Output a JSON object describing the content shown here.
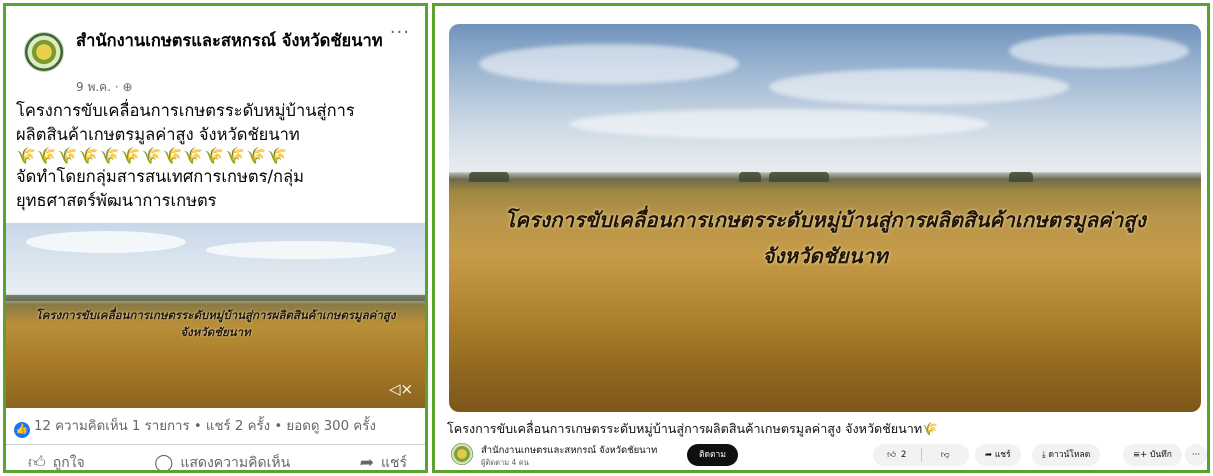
{
  "facebook_post": {
    "page_name": "สำนักงานเกษตรและสหกรณ์ จังหวัดชัยนาท",
    "date": "9 พ.ค. · ",
    "audience_icon": "globe-icon",
    "more_icon": "···",
    "text_lines": [
      "โครงการขับเคลื่อนการเกษตรระดับหมู่บ้านสู่การ",
      "ผลิตสินค้าเกษตรมูลค่าสูง จังหวัดชัยนาท",
      "🌾🌾🌾🌾🌾🌾🌾🌾🌾🌾🌾🌾🌾",
      "จัดทำโดยกลุ่มสารสนเทศการเกษตร/กลุ่ม",
      "ยุทธศาสตร์พัฒนาการเกษตร"
    ],
    "video_overlay_lines": [
      "โครงการขับเคลื่อนการเกษตรระดับหมู่บ้านสู่การผลิตสินค้าเกษตรมูลค่าสูง",
      "จังหวัดชัยนาท"
    ],
    "mute_icon": "🔇",
    "stats": "12  ความคิดเห็น 1 รายการ • แชร์ 2 ครั้ง • ยอดดู 300 ครั้ง",
    "actions": {
      "like": "ถูกใจ",
      "comment": "แสดงความคิดเห็น",
      "share": "แชร์"
    }
  },
  "youtube": {
    "overlay_lines": [
      "โครงการขับเคลื่อนการเกษตรระดับหมู่บ้านสู่การผลิตสินค้าเกษตรมูลค่าสูง",
      "จังหวัดชัยนาท"
    ],
    "title": "โครงการขับเคลื่อนการเกษตรระดับหมู่บ้านสู่การผลิตสินค้าเกษตรมูลค่าสูง จังหวัดชัยนาท",
    "title_emoji": "🌾",
    "channel_name": "สำนักงานเกษตรและสหกรณ์ จังหวัดชัยนาท",
    "subscribers": "ผู้ติดตาม 4 คน",
    "subscribe_label": "ติดตาม",
    "like_count": "2",
    "share_label": "แชร์",
    "download_label": "ดาวน์โหลด",
    "save_label": "บันทึก",
    "more_label": "···"
  },
  "colors": {
    "frame_border": "#5aa12d",
    "fb_blue": "#1877f2",
    "secondary_text": "#65676b",
    "yt_black": "#0f0f0f"
  }
}
